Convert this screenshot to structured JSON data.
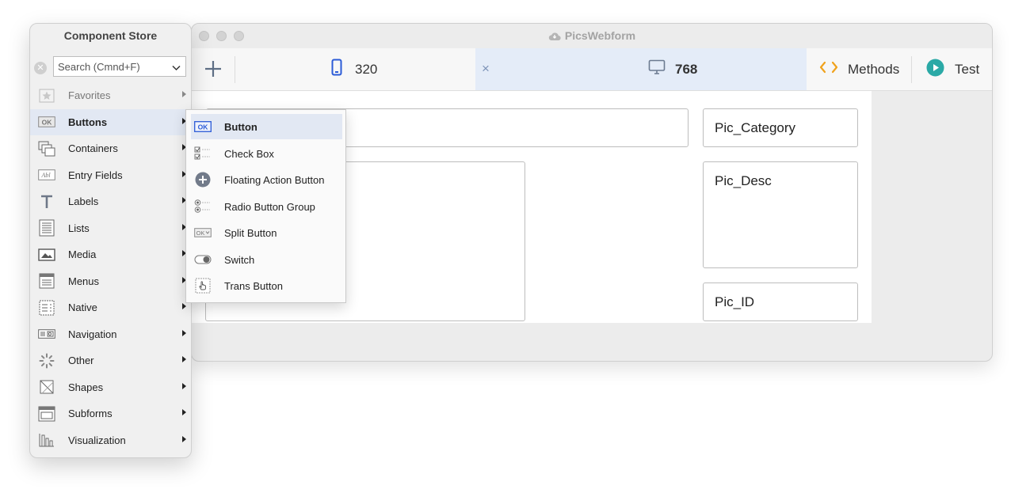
{
  "window": {
    "title": "PicsWebform"
  },
  "toolbar": {
    "tab_320": "320",
    "tab_768": "768",
    "close": "×",
    "methods_label": "Methods",
    "test_label": "Test"
  },
  "canvas": {
    "fields": [
      "Pic_Category",
      "Pic_Desc",
      "Pic_ID"
    ]
  },
  "store": {
    "title": "Component Store",
    "search_placeholder": "Search (Cmnd+F)",
    "categories": [
      {
        "label": "Favorites",
        "icon": "star-icon"
      },
      {
        "label": "Buttons",
        "icon": "ok-button-icon"
      },
      {
        "label": "Containers",
        "icon": "containers-icon"
      },
      {
        "label": "Entry Fields",
        "icon": "entry-field-icon"
      },
      {
        "label": "Labels",
        "icon": "text-t-icon"
      },
      {
        "label": "Lists",
        "icon": "list-icon"
      },
      {
        "label": "Media",
        "icon": "media-icon"
      },
      {
        "label": "Menus",
        "icon": "menu-icon"
      },
      {
        "label": "Native",
        "icon": "native-icon"
      },
      {
        "label": "Navigation",
        "icon": "navigation-icon"
      },
      {
        "label": "Other",
        "icon": "spinner-icon"
      },
      {
        "label": "Shapes",
        "icon": "shapes-icon"
      },
      {
        "label": "Subforms",
        "icon": "subform-icon"
      },
      {
        "label": "Visualization",
        "icon": "chart-icon"
      }
    ],
    "selected": "Buttons"
  },
  "submenu": {
    "items": [
      {
        "label": "Button",
        "icon": "ok-button-icon"
      },
      {
        "label": "Check Box",
        "icon": "checkbox-icon"
      },
      {
        "label": "Floating Action Button",
        "icon": "fab-plus-icon"
      },
      {
        "label": "Radio Button Group",
        "icon": "radio-icon"
      },
      {
        "label": "Split Button",
        "icon": "split-button-icon"
      },
      {
        "label": "Switch",
        "icon": "switch-icon"
      },
      {
        "label": "Trans Button",
        "icon": "hand-pointer-icon"
      }
    ]
  },
  "colors": {
    "selection": "#e2e8f3",
    "accent_blue": "#2b5bd7",
    "methods_orange": "#f0a21c",
    "test_teal": "#2aa9a6"
  }
}
